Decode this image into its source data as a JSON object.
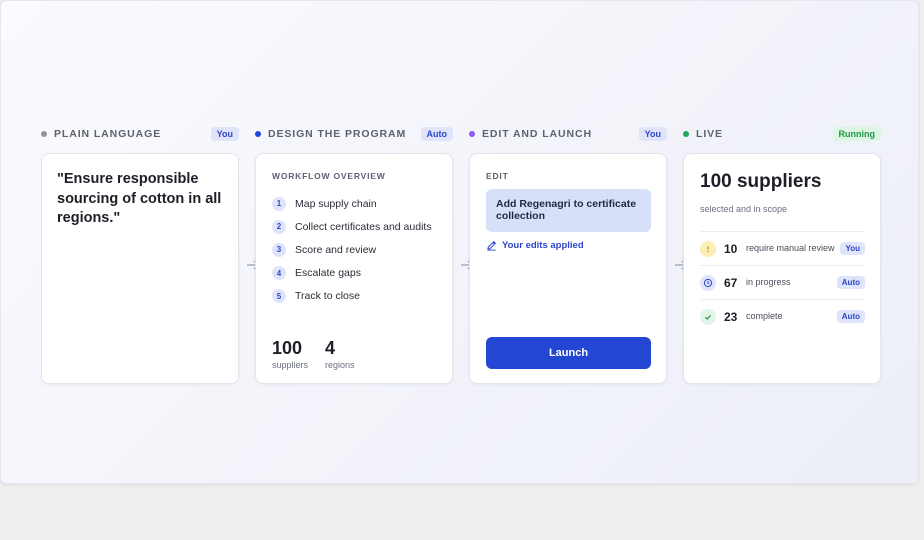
{
  "colors": {
    "stage1_dot": "#8e939e",
    "stage2_dot": "#2347d2",
    "stage3_dot": "#8b5cf6",
    "stage4_dot": "#22a45a",
    "accent": "#2347d2"
  },
  "stages": [
    {
      "label": "PLAIN LANGUAGE",
      "badge": "You"
    },
    {
      "label": "DESIGN THE PROGRAM",
      "badge": "Auto"
    },
    {
      "label": "EDIT AND LAUNCH",
      "badge": "You"
    },
    {
      "label": "LIVE",
      "badge": "Running"
    }
  ],
  "plain_language": {
    "quote": "\"Ensure responsible sourcing of cotton in all regions.\""
  },
  "design": {
    "section_label": "WORKFLOW OVERVIEW",
    "steps": [
      {
        "num": "1",
        "text": "Map supply chain"
      },
      {
        "num": "2",
        "text": "Collect certificates and audits"
      },
      {
        "num": "3",
        "text": "Score and review"
      },
      {
        "num": "4",
        "text": "Escalate gaps"
      },
      {
        "num": "5",
        "text": "Track to close"
      }
    ],
    "stats": [
      {
        "value": "100",
        "caption": "suppliers"
      },
      {
        "value": "4",
        "caption": "regions"
      }
    ]
  },
  "edit": {
    "section_label": "EDIT",
    "edit_text": "Add Regenagri to certificate collection",
    "edits_applied": "Your edits applied",
    "launch_label": "Launch",
    "icon": "pencil-icon"
  },
  "live": {
    "title": "100 suppliers",
    "subtitle": "selected and in scope",
    "rows": [
      {
        "icon": "alert-icon",
        "value": "10",
        "label": "require manual review",
        "badge": "You"
      },
      {
        "icon": "clock-icon",
        "value": "67",
        "label": "in progress",
        "badge": "Auto"
      },
      {
        "icon": "check-icon",
        "value": "23",
        "label": "complete",
        "badge": "Auto"
      }
    ]
  }
}
